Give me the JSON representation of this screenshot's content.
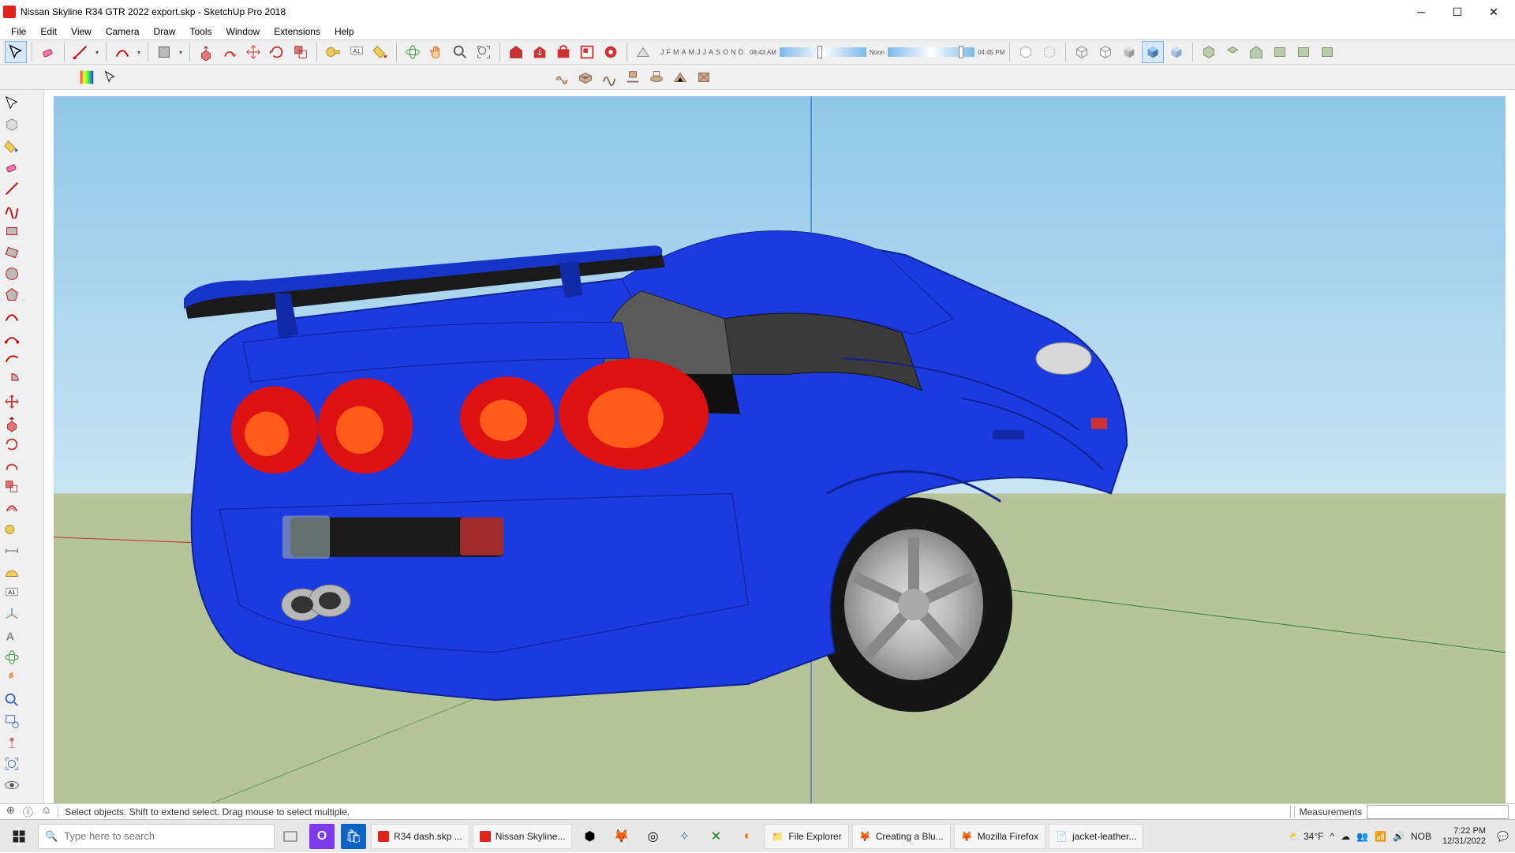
{
  "window": {
    "title": "Nissan Skyline R34 GTR 2022 export.skp - SketchUp Pro 2018"
  },
  "menu": [
    "File",
    "Edit",
    "View",
    "Camera",
    "Draw",
    "Tools",
    "Window",
    "Extensions",
    "Help"
  ],
  "shadow_bar": {
    "months": [
      "J",
      "F",
      "M",
      "A",
      "M",
      "J",
      "J",
      "A",
      "S",
      "O",
      "N",
      "D"
    ],
    "time_start": "08:43 AM",
    "time_noon": "Noon",
    "time_end": "04:45 PM"
  },
  "status": {
    "hint": "Select objects. Shift to extend select. Drag mouse to select multiple.",
    "measurements_label": "Measurements"
  },
  "taskbar": {
    "search_placeholder": "Type here to search",
    "tasks": [
      {
        "icon": "sketchup",
        "label": "R34 dash.skp ..."
      },
      {
        "icon": "sketchup",
        "label": "Nissan Skyline..."
      },
      {
        "icon": "folder",
        "label": "File Explorer"
      },
      {
        "icon": "firefox",
        "label": "Creating a Blu..."
      },
      {
        "icon": "firefox",
        "label": "Mozilla Firefox"
      },
      {
        "icon": "pdf",
        "label": "jacket-leather..."
      }
    ],
    "weather_temp": "34°F",
    "tray_lang": "NOB",
    "clock_time": "7:22 PM",
    "clock_date": "12/31/2022"
  }
}
